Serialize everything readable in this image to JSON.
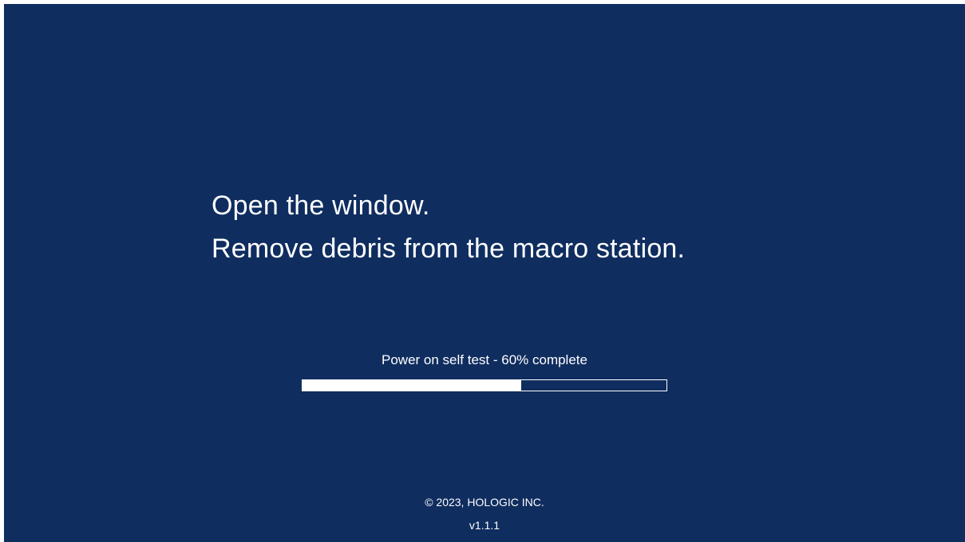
{
  "instructions": [
    "Open the window.",
    "Remove debris from the macro station."
  ],
  "status": {
    "text": "Power on self test - 60% complete",
    "progress_percent": 60
  },
  "footer": {
    "copyright": "© 2023, HOLOGIC INC.",
    "version": "v1.1.1"
  },
  "colors": {
    "background": "#0f2d5f",
    "text": "#ffffff",
    "progress_fill": "#ffffff"
  }
}
